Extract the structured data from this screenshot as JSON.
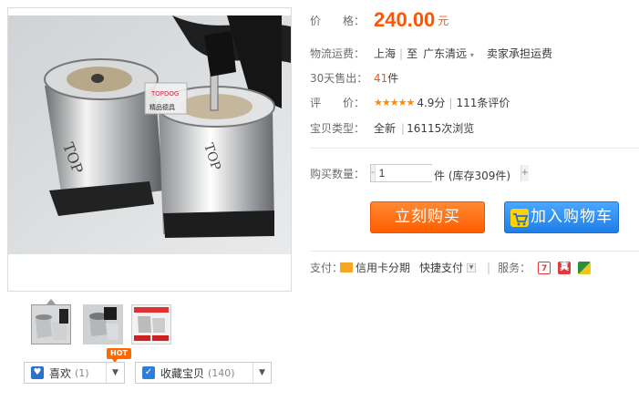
{
  "price": {
    "label": "价　　格：",
    "value": "240.00",
    "unit": "元"
  },
  "shipping": {
    "label": "物流运费：",
    "from": "上海",
    "separator": "至",
    "to": "广东清远",
    "note": "卖家承担运费"
  },
  "sales": {
    "label": "30天售出：",
    "count": "41",
    "unit": "件"
  },
  "rating": {
    "label": "评　　价：",
    "stars": "★★★★★",
    "score": "4.9分",
    "reviews": "111条评价"
  },
  "item_type": {
    "label": "宝贝类型：",
    "condition": "全新",
    "views": "16115次浏览"
  },
  "quantity": {
    "label": "购买数量：",
    "minus": "-",
    "value": "1",
    "plus": "+",
    "stock": "件 (库存309件)"
  },
  "actions": {
    "buy_now": "立刻购买",
    "add_to_cart": "加入购物车"
  },
  "payment": {
    "label": "支付：",
    "installment": "信用卡分期",
    "quick_pay": "快捷支付"
  },
  "service": {
    "label": "服务："
  },
  "gallery": {
    "watermark_top": "TOPDOG",
    "watermark_bottom": "精品德具"
  },
  "social": {
    "hot_badge": "HOT",
    "like_label": "喜欢",
    "like_count": "(1)",
    "favorite_label": "收藏宝贝",
    "favorite_count": "(140)"
  },
  "colors": {
    "accent": "#ff5500",
    "cart_blue": "#1f7ee8",
    "star": "#ff8a00"
  }
}
